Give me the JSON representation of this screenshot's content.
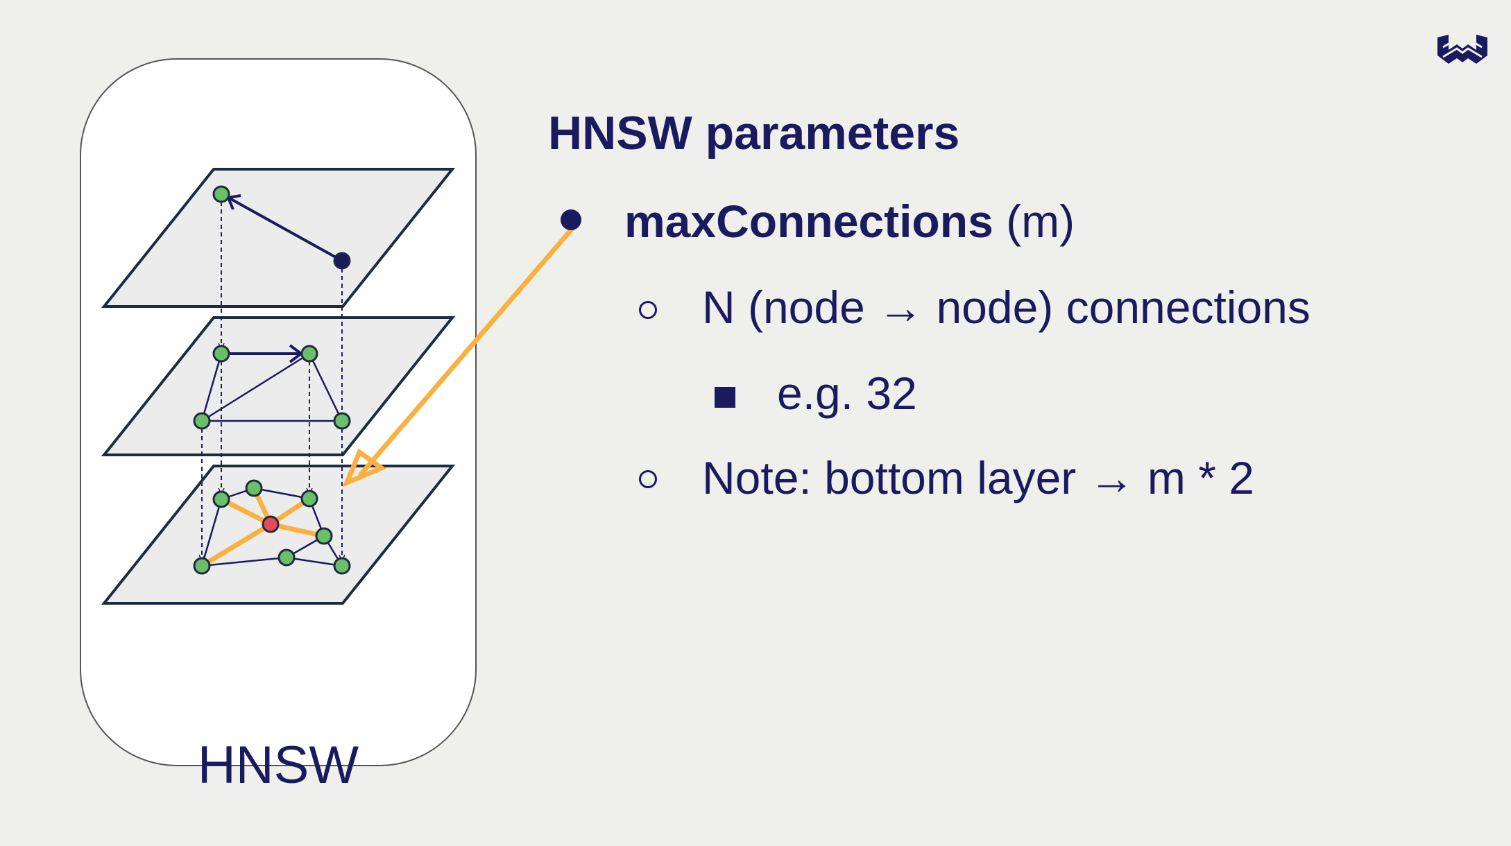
{
  "diagram": {
    "card_label": "HNSW"
  },
  "slide": {
    "title": "HNSW parameters",
    "bullet1": {
      "strong": "maxConnections",
      "rest": " (m)"
    },
    "bullet2": "N (node → node) connections",
    "bullet3": "e.g. 32",
    "bullet4": "Note: bottom layer → m * 2"
  },
  "colors": {
    "navy": "#1c1a5e",
    "orange": "#fbb040",
    "node_green": "#6abf69",
    "node_red": "#e64a5a",
    "layer_fill": "#ececec"
  },
  "icons": [
    "brand-logo-icon"
  ]
}
